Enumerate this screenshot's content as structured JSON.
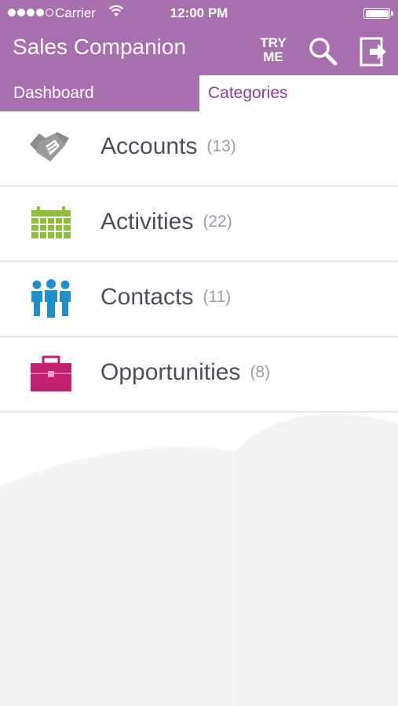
{
  "status_bar": {
    "carrier": "Carrier",
    "time": "12:00 PM"
  },
  "header": {
    "title": "Sales Companion",
    "try_me": "TRY ME",
    "search_icon": "search-icon",
    "logout_icon": "logout-icon",
    "background_color": "#a86fae"
  },
  "tabs": [
    {
      "label": "Dashboard",
      "selected": false
    },
    {
      "label": "Categories",
      "selected": true
    }
  ],
  "categories": [
    {
      "label": "Accounts",
      "count": "(13)",
      "icon": "handshake-icon",
      "color": "#8a8a8a"
    },
    {
      "label": "Activities",
      "count": "(22)",
      "icon": "calendar-icon",
      "color": "#8fbf3a"
    },
    {
      "label": "Contacts",
      "count": "(11)",
      "icon": "people-icon",
      "color": "#1f8fc6"
    },
    {
      "label": "Opportunities",
      "count": "(8)",
      "icon": "briefcase-icon",
      "color": "#c21f6e"
    }
  ]
}
